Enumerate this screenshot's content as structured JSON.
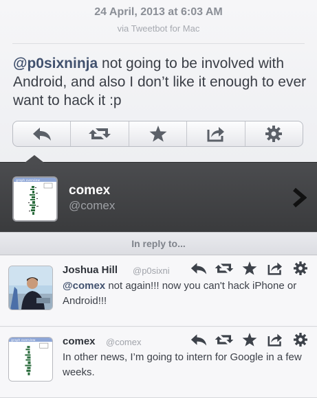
{
  "tweet": {
    "date": "24 April, 2013 at 6:03 AM",
    "via": "via Tweetbot for Mac",
    "mention": "@p0sixninja",
    "text": " not going to be involved with Android, and also I don’t like it enough to ever want to hack it :p"
  },
  "actions": [
    "reply-icon",
    "retweet-icon",
    "star-icon",
    "share-icon",
    "gear-icon"
  ],
  "profile": {
    "name": "comex",
    "handle": "@comex",
    "avatar_text": "graph overview"
  },
  "reply_header": "In reply to...",
  "replies": [
    {
      "name": "Joshua Hill",
      "handle": "@p0sixni",
      "mention": "@comex",
      "text": " not again!!! now you can't hack iPhone or Android!!!"
    },
    {
      "name": "comex",
      "handle": "@comex",
      "text": "In other news, I’m going to intern for Google in a few weeks."
    }
  ],
  "colors": {
    "accent_mention": "#41516e",
    "profile_bg": "#444547",
    "icon": "#5b6068"
  }
}
